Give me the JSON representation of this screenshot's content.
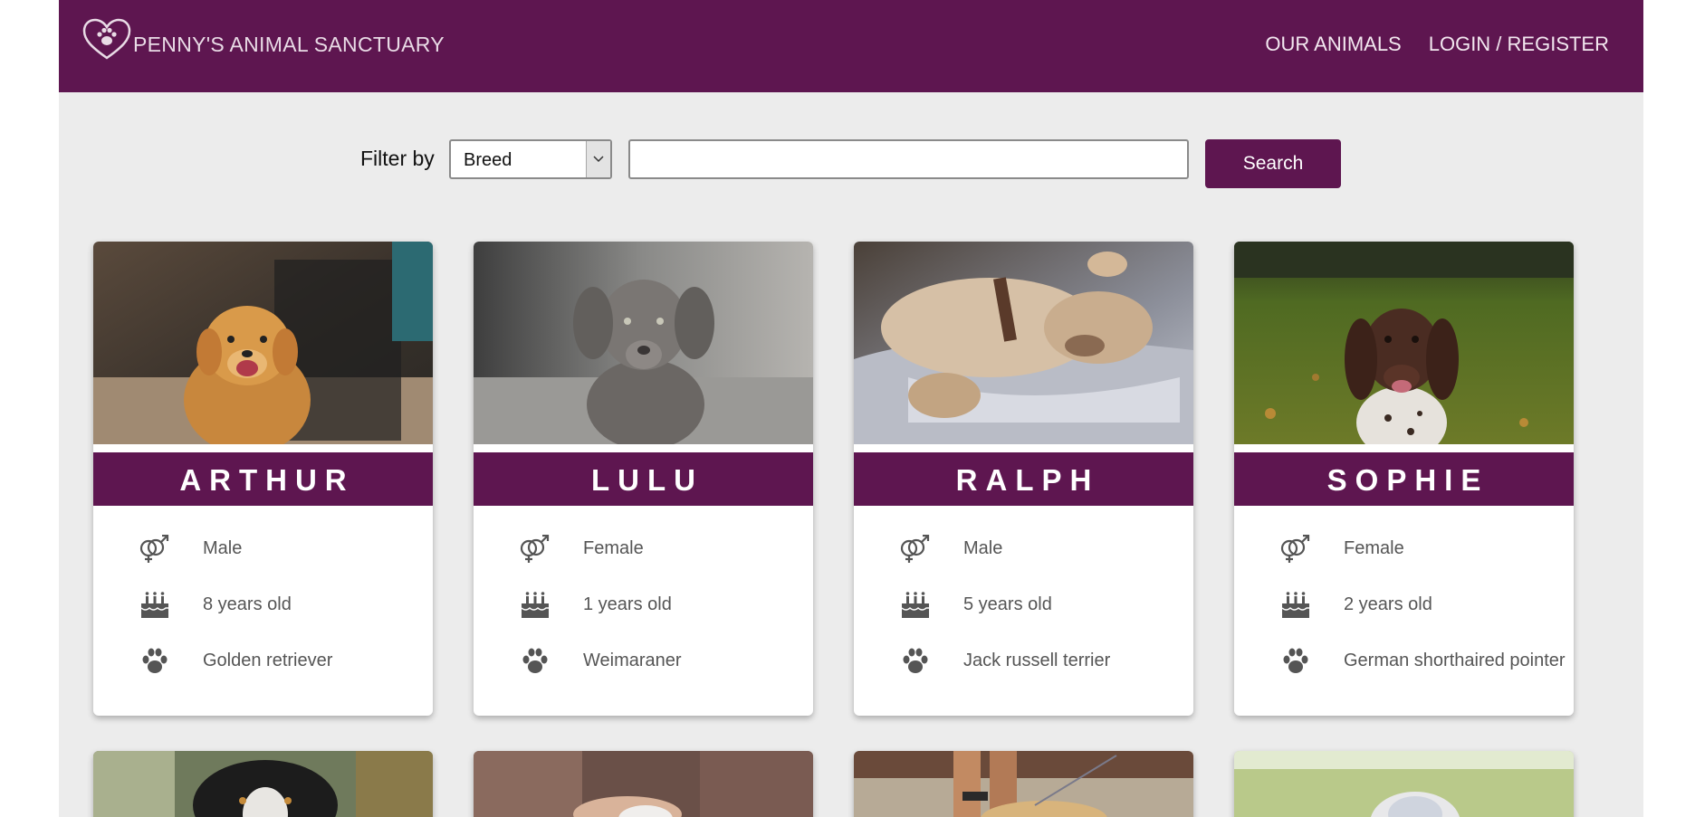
{
  "header": {
    "brand": "PENNY'S ANIMAL SANCTUARY",
    "nav": [
      {
        "label": "OUR ANIMALS"
      },
      {
        "label": "LOGIN / REGISTER"
      }
    ]
  },
  "filter": {
    "label": "Filter by",
    "selected": "Breed",
    "search_value": "",
    "search_button": "Search"
  },
  "animals": [
    {
      "name": "ARTHUR",
      "gender": "Male",
      "age": "8 years old",
      "breed": "Golden retriever"
    },
    {
      "name": "LULU",
      "gender": "Female",
      "age": "1 years old",
      "breed": "Weimaraner"
    },
    {
      "name": "RALPH",
      "gender": "Male",
      "age": "5 years old",
      "breed": "Jack russell terrier"
    },
    {
      "name": "SOPHIE",
      "gender": "Female",
      "age": "2 years old",
      "breed": "German shorthaired pointer"
    }
  ],
  "colors": {
    "brand": "#5e1650",
    "background": "#ececec",
    "text_muted": "#555555"
  },
  "icons": {
    "logo": "heart-paw-icon",
    "gender": "gender-icon",
    "age": "birthday-cake-icon",
    "breed": "paw-icon"
  }
}
